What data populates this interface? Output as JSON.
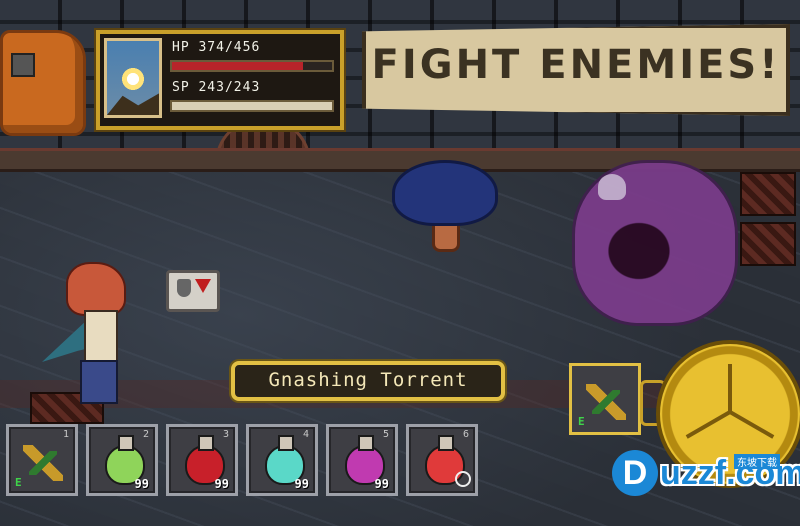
{
  "status": {
    "hp_label": "HP 374/456",
    "hp_fraction": 0.82,
    "sp_label": "SP 243/243",
    "sp_fraction": 1.0
  },
  "banner": {
    "text": "FIGHT ENEMIES!"
  },
  "skill": {
    "name": "Gnashing Torrent"
  },
  "hotbar": {
    "slots": [
      {
        "number": "1",
        "item": "scroll-icon",
        "quantity": "",
        "equipped": "E"
      },
      {
        "number": "2",
        "item": "green-potion-icon",
        "quantity": "99"
      },
      {
        "number": "3",
        "item": "red-potion-icon",
        "quantity": "99"
      },
      {
        "number": "4",
        "item": "cyan-potion-icon",
        "quantity": "99"
      },
      {
        "number": "5",
        "item": "purple-potion-icon",
        "quantity": "99"
      },
      {
        "number": "6",
        "item": "red-potion-icon",
        "quantity": ""
      }
    ]
  },
  "equipped_item": {
    "badge": "E",
    "item": "scroll-icon"
  },
  "watermark": {
    "letter": "D",
    "text": "uzzf.com",
    "sub": "东坡下载"
  },
  "colors": {
    "gold_frame": "#e2c044",
    "hp": "#b8242a",
    "sp": "#d9cfb5",
    "equip_green": "#3fd44a"
  }
}
